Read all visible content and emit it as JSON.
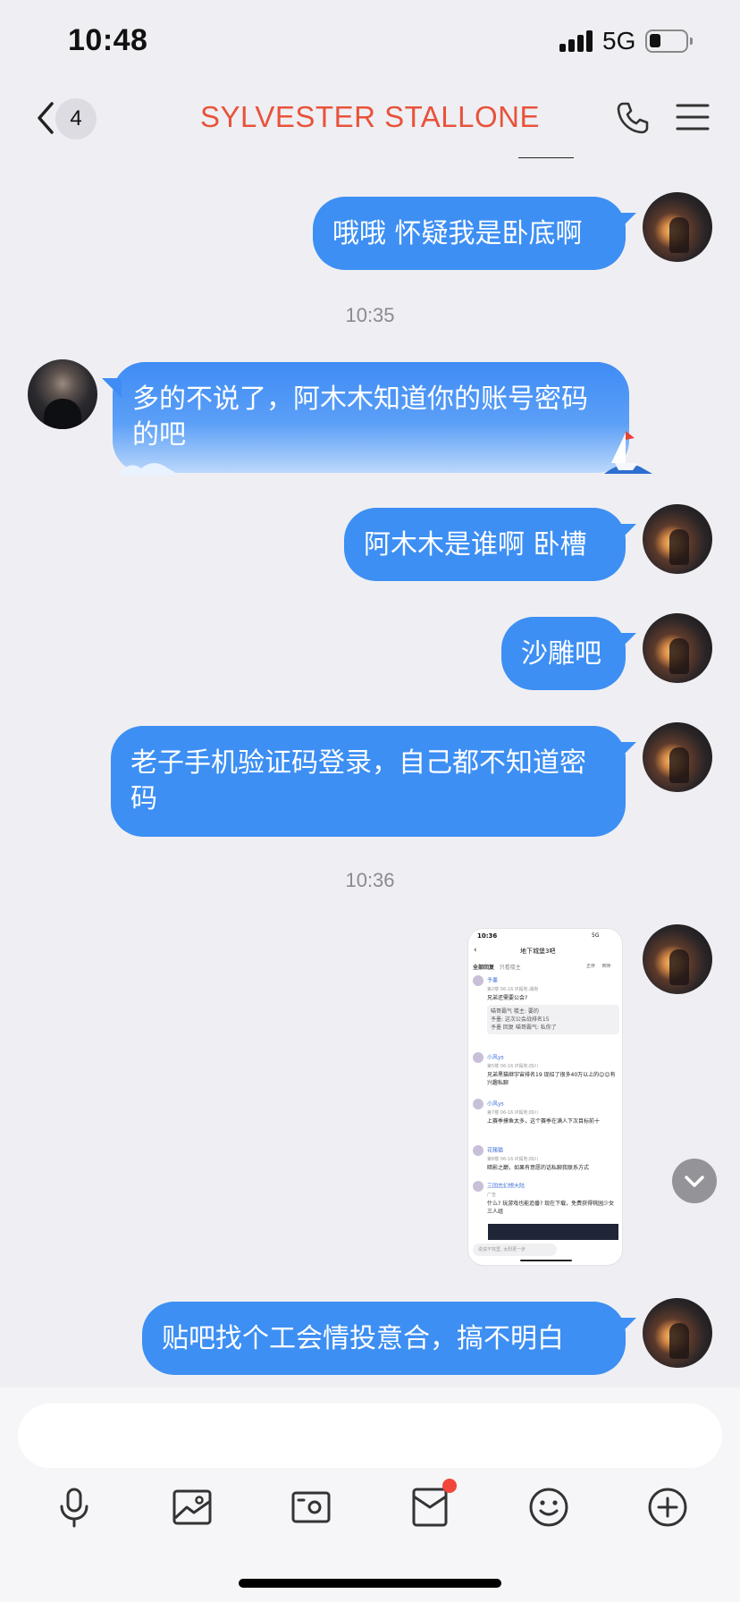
{
  "status_bar": {
    "time": "10:48",
    "network": "5G"
  },
  "header": {
    "title": "SYLVESTER STALLONE",
    "unread_count": "4"
  },
  "messages": [
    {
      "sender": "self",
      "text": "哦哦 怀疑我是卧底啊"
    },
    {
      "timestamp": "10:35"
    },
    {
      "sender": "other",
      "text": "多的不说了，阿木木知道你的账号密码的吧"
    },
    {
      "sender": "self",
      "text": "阿木木是谁啊 卧槽"
    },
    {
      "sender": "self",
      "text": "沙雕吧"
    },
    {
      "sender": "self",
      "text": "老子手机验证码登录，自己都不知道密码"
    },
    {
      "timestamp": "10:36"
    },
    {
      "sender": "self",
      "type": "image",
      "image": {
        "time": "10:36",
        "net": "5G",
        "title": "地下城堡3吧",
        "tab_all": "全部回复",
        "tab_host": "只看楼主",
        "sort_hot": "正序",
        "sort_new": "倒序",
        "posts": [
          {
            "name": "予墨",
            "meta": "第2楼 06-16 IP属地:湖南",
            "text": "兄弟还需要公会?",
            "quotes": [
              "喵哥霸气 楼主: 要的",
              "予墨: 这次公会战排名15",
              "予墨 回复 喵哥霸气: 私你了"
            ]
          },
          {
            "name": "小风ys",
            "meta": "第5楼 06-16 IP属地:四川",
            "text": "兄弟黑猫继宇宙排名19 现招了很多40万以上的😊😊有兴趣私聊"
          },
          {
            "name": "小风ys",
            "meta": "第7楼 06-16 IP属地:四川",
            "text": "上赛季摸鱼太多，这个赛季在满人下次目标前十"
          },
          {
            "name": "花猪猫",
            "meta": "第8楼 06-16 IP属地:四川",
            "text": "暗影之巅，如果有意愿的话私聊我联系方式"
          },
          {
            "name": "三国志幻想大陆",
            "meta": "广告",
            "text": "什么? 玩游戏也能追番? 现在下载，免费获得桃园少女三人组"
          }
        ],
        "input_placeholder": "说说不完里, 太阳更一步"
      }
    },
    {
      "sender": "self",
      "text": "贴吧找个工会情投意合，搞不明白"
    }
  ],
  "input_bar": {
    "placeholder": "",
    "tools": [
      "microphone-icon",
      "image-icon",
      "camera-icon",
      "red-packet-icon",
      "emoji-icon",
      "plus-icon"
    ]
  },
  "colors": {
    "accent_title": "#e8533b",
    "bubble_blue": "#3d8ff3",
    "notification_red": "#f2453b",
    "background": "#efeff3"
  }
}
